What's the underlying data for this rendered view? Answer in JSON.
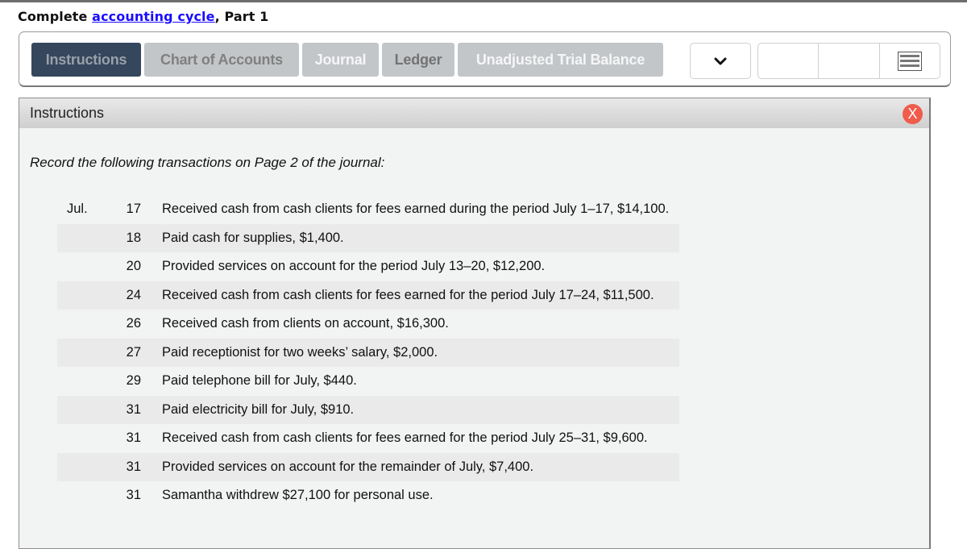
{
  "header": {
    "title_prefix": "Complete ",
    "title_link": "accounting cycle",
    "title_suffix": ", Part 1"
  },
  "tabs": [
    {
      "label": "Instructions",
      "state": "active"
    },
    {
      "label": "Chart of Accounts",
      "state": "inactive"
    },
    {
      "label": "Journal",
      "state": "inactive"
    },
    {
      "label": "Ledger",
      "state": "inactive"
    },
    {
      "label": "Unadjusted Trial Balance",
      "state": "inactive"
    }
  ],
  "toolbar": {
    "dropdown_icon": "chevron-down-icon",
    "menu_icon": "menu-icon"
  },
  "panel": {
    "title": "Instructions",
    "close_label": "X",
    "intro": "Record the following transactions on Page 2 of the journal:",
    "month": "Jul.",
    "transactions": [
      {
        "day": "17",
        "description": "Received cash from cash clients for fees earned during the period July 1–17, $14,100."
      },
      {
        "day": "18",
        "description": "Paid cash for supplies, $1,400."
      },
      {
        "day": "20",
        "description": "Provided services on account for the period July 13–20, $12,200."
      },
      {
        "day": "24",
        "description": "Received cash from cash clients for fees earned for the period July 17–24, $11,500."
      },
      {
        "day": "26",
        "description": "Received cash from clients on account, $16,300."
      },
      {
        "day": "27",
        "description": "Paid receptionist for two weeks’ salary, $2,000."
      },
      {
        "day": "29",
        "description": "Paid telephone bill for July, $440."
      },
      {
        "day": "31",
        "description": "Paid electricity bill for July, $910."
      },
      {
        "day": "31",
        "description": "Received cash from cash clients for fees earned for the period July 25–31, $9,600."
      },
      {
        "day": "31",
        "description": "Provided services on account for the remainder of July, $7,400."
      },
      {
        "day": "31",
        "description": "Samantha withdrew $27,100 for personal use."
      }
    ]
  },
  "colors": {
    "active_tab": "#35475d",
    "inactive_tab": "#c3c6c9",
    "link": "#1a0dff",
    "close_button": "#f05b4b",
    "panel_bg": "#f2f3f3",
    "alt_row": "#eaeaea"
  }
}
